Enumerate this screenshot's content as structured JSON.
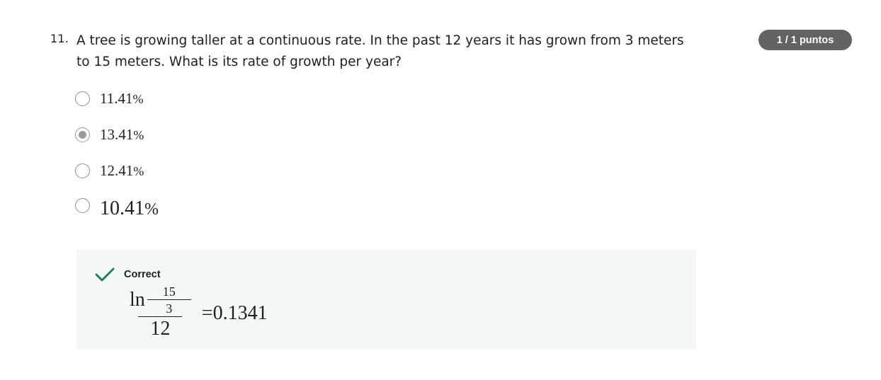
{
  "question": {
    "number": "11.",
    "text": "A tree is growing taller at a continuous rate. In the past 12 years it has grown from 3 meters to 15 meters. What is its rate of growth per year?",
    "score": "1 / 1 puntos"
  },
  "options": [
    {
      "value": "11.41",
      "unit": "%",
      "selected": false
    },
    {
      "value": "13.41",
      "unit": "%",
      "selected": true
    },
    {
      "value": "12.41",
      "unit": "%",
      "selected": false
    },
    {
      "value": "10.41",
      "unit": "%",
      "selected": false
    }
  ],
  "feedback": {
    "status": "Correct",
    "icon": "check-icon",
    "formula": {
      "fn": "ln",
      "inner_numerator": "15",
      "inner_denominator": "3",
      "denominator": "12",
      "result": "=0.1341"
    }
  },
  "colors": {
    "badge_bg": "#636363",
    "feedback_bg": "#f3f8f6",
    "check_green": "#1e7a4f",
    "radio_selected": "#9b9b9b"
  }
}
